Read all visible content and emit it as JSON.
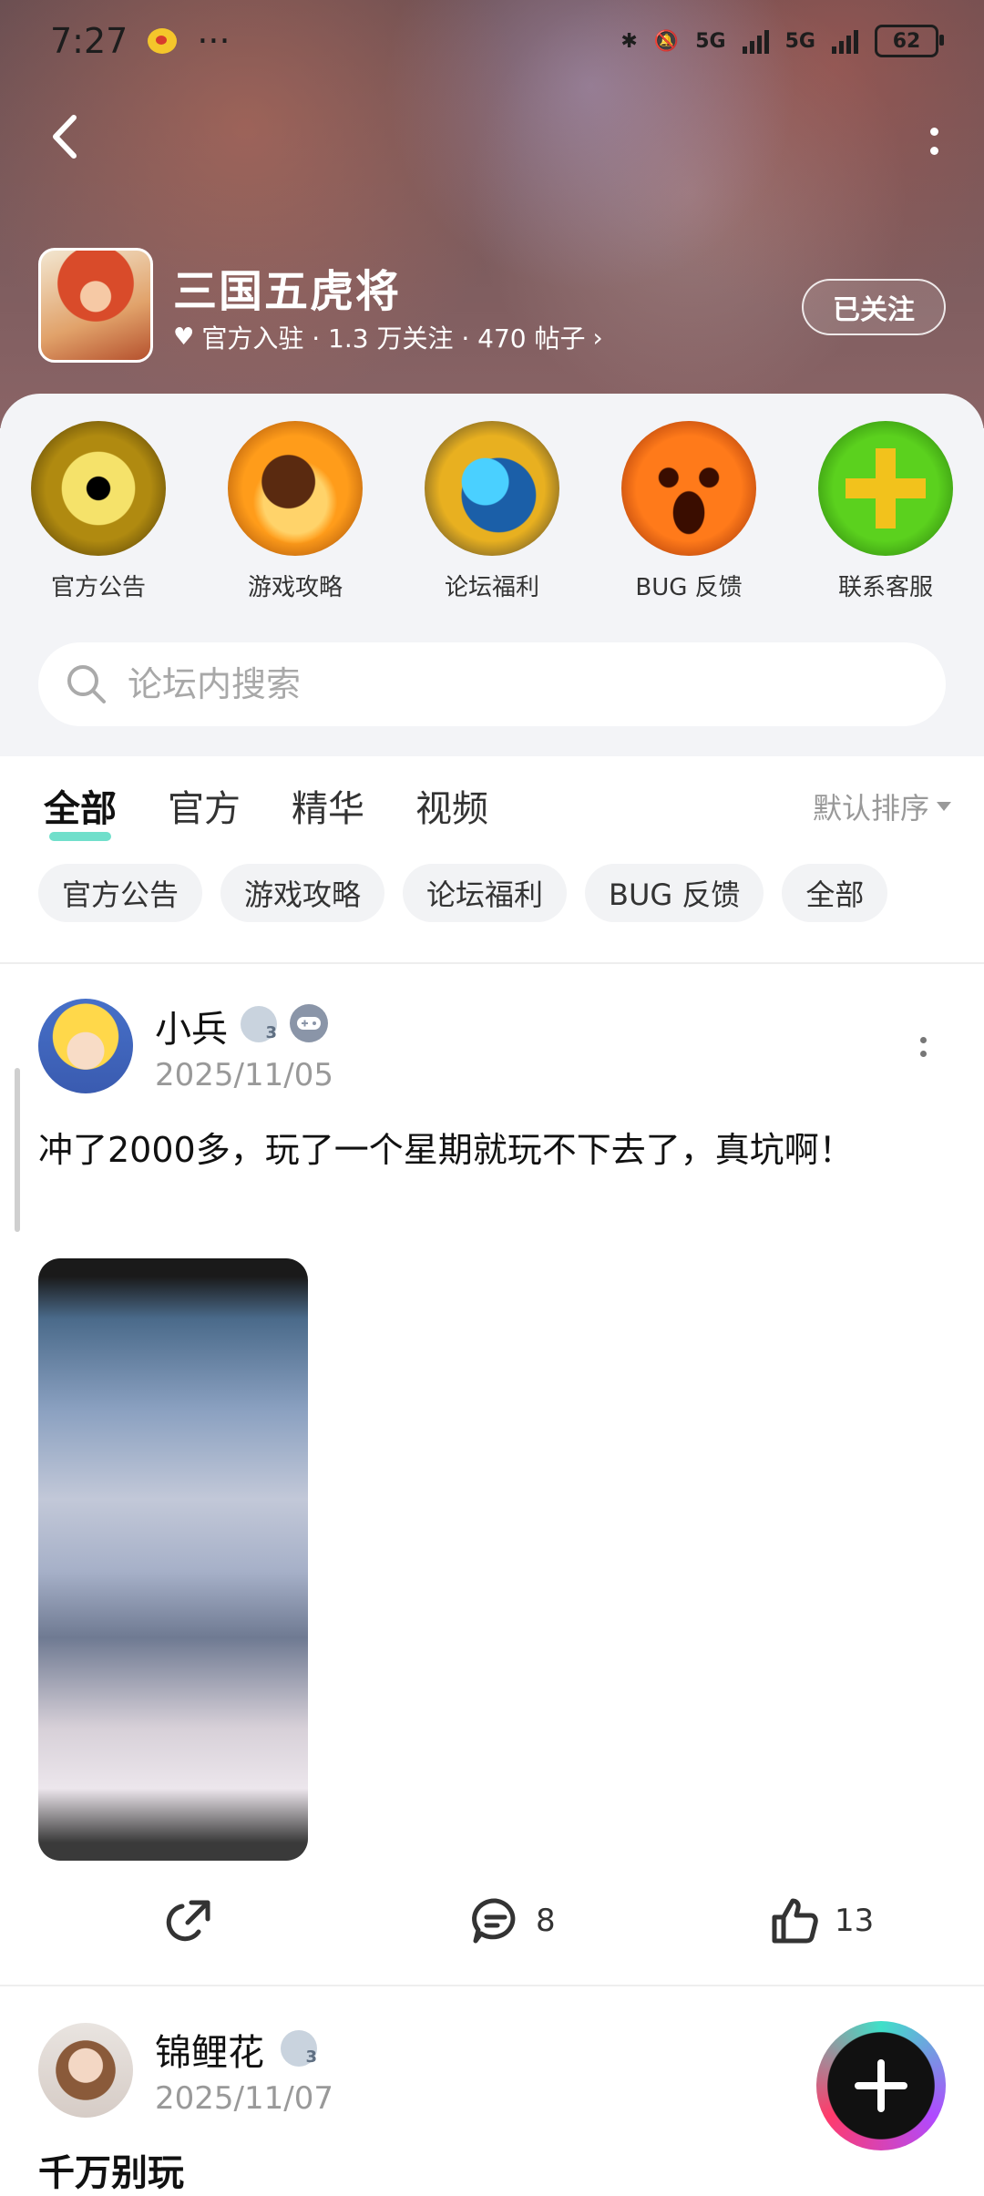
{
  "status_bar": {
    "time": "7:27",
    "network_1": "5G",
    "network_2": "5G",
    "battery": "62"
  },
  "header": {
    "game_title": "三国五虎将",
    "meta": "官方入驻 · 1.3 万关注 · 470 帖子",
    "follow_label": "已关注"
  },
  "categories": [
    {
      "label": "官方公告",
      "icon": "eye-icon"
    },
    {
      "label": "游戏攻略",
      "icon": "flame-hand-icon"
    },
    {
      "label": "论坛福利",
      "icon": "gift-fist-icon"
    },
    {
      "label": "BUG 反馈",
      "icon": "pumpkin-icon"
    },
    {
      "label": "联系客服",
      "icon": "plus-cross-icon"
    }
  ],
  "search": {
    "placeholder": "论坛内搜索"
  },
  "tabs": [
    {
      "label": "全部",
      "active": true
    },
    {
      "label": "官方",
      "active": false
    },
    {
      "label": "精华",
      "active": false
    },
    {
      "label": "视频",
      "active": false
    }
  ],
  "sort_label": "默认排序",
  "chips": [
    "官方公告",
    "游戏攻略",
    "论坛福利",
    "BUG 反馈",
    "全部"
  ],
  "posts": [
    {
      "username": "小兵",
      "level_badge": "3",
      "date": "2025/11/05",
      "text": "冲了2000多，玩了一个星期就玩不下去了，真坑啊！",
      "comments": "8",
      "likes": "13"
    },
    {
      "username": "锦鲤花",
      "level_badge": "3",
      "date": "2025/11/07",
      "title": "千万别玩"
    }
  ],
  "colors": {
    "accent": "#33d1b5",
    "hero_bg": "#7a5a5c",
    "panel_bg": "#f3f4f7"
  }
}
